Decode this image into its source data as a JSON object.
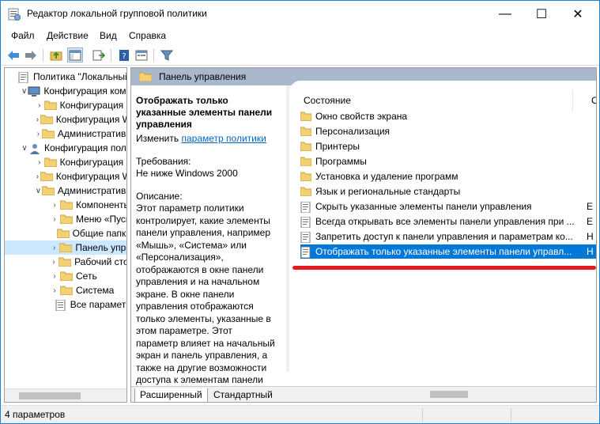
{
  "window": {
    "title": "Редактор локальной групповой политики"
  },
  "titlebar_buttons": {
    "minimize": "—",
    "maximize": "☐",
    "close": "✕"
  },
  "menu": [
    "Файл",
    "Действие",
    "Вид",
    "Справка"
  ],
  "tree": [
    {
      "label": "Политика \"Локальный",
      "level": 0,
      "expander": "",
      "icon": "policy-icon"
    },
    {
      "label": "Конфигурация комп",
      "level": 1,
      "expander": "∨",
      "icon": "computer-icon"
    },
    {
      "label": "Конфигурация п",
      "level": 2,
      "expander": "›",
      "icon": "folder-icon"
    },
    {
      "label": "Конфигурация W",
      "level": 2,
      "expander": "›",
      "icon": "folder-icon"
    },
    {
      "label": "Административн",
      "level": 2,
      "expander": "›",
      "icon": "folder-icon"
    },
    {
      "label": "Конфигурация поль",
      "level": 1,
      "expander": "∨",
      "icon": "user-icon"
    },
    {
      "label": "Конфигурация п",
      "level": 2,
      "expander": "›",
      "icon": "folder-icon"
    },
    {
      "label": "Конфигурация W",
      "level": 2,
      "expander": "›",
      "icon": "folder-icon"
    },
    {
      "label": "Административн",
      "level": 2,
      "expander": "∨",
      "icon": "folder-icon"
    },
    {
      "label": "Компоненты",
      "level": 3,
      "expander": "›",
      "icon": "folder-icon"
    },
    {
      "label": "Меню «Пуск",
      "level": 3,
      "expander": "›",
      "icon": "folder-icon"
    },
    {
      "label": "Общие папки",
      "level": 3,
      "expander": "",
      "icon": "folder-icon"
    },
    {
      "label": "Панель упра",
      "level": 3,
      "expander": "›",
      "icon": "folder-icon",
      "selected": true
    },
    {
      "label": "Рабочий сто.",
      "level": 3,
      "expander": "›",
      "icon": "folder-icon"
    },
    {
      "label": "Сеть",
      "level": 3,
      "expander": "›",
      "icon": "folder-icon"
    },
    {
      "label": "Система",
      "level": 3,
      "expander": "›",
      "icon": "folder-icon"
    },
    {
      "label": "Все параметр",
      "level": 3,
      "expander": "",
      "icon": "all-settings-icon"
    }
  ],
  "header": {
    "title": "Панель управления"
  },
  "description": {
    "title": "Отображать только указанные элементы панели управления",
    "edit_prefix": "Изменить",
    "edit_link": "параметр политики",
    "requirements_label": "Требования:",
    "requirements_value": "Не ниже Windows 2000",
    "description_label": "Описание:",
    "description_body": "Этот параметр политики контролирует, какие элементы панели управления, например «Мышь», «Система» или «Персонализация», отображаются в окне панели управления и на начальном экране. В окне панели управления отображаются только элементы, указанные в этом параметре. Этот параметр влияет на начальный экран и панель управления, а также на другие возможности доступа к элементам панели управления, например ссылки в центре"
  },
  "list": {
    "column_state": "Состояние",
    "column_second": "С",
    "items": [
      {
        "label": "Окно свойств экрана",
        "type": "folder",
        "trail": ""
      },
      {
        "label": "Персонализация",
        "type": "folder",
        "trail": ""
      },
      {
        "label": "Принтеры",
        "type": "folder",
        "trail": ""
      },
      {
        "label": "Программы",
        "type": "folder",
        "trail": ""
      },
      {
        "label": "Установка и удаление программ",
        "type": "folder",
        "trail": ""
      },
      {
        "label": "Язык и региональные стандарты",
        "type": "folder",
        "trail": ""
      },
      {
        "label": "Скрыть указанные элементы панели управления",
        "type": "setting",
        "trail": "Е"
      },
      {
        "label": "Всегда открывать все элементы панели управления при ...",
        "type": "setting",
        "trail": "Е"
      },
      {
        "label": "Запретить доступ к панели управления и параметрам ко...",
        "type": "setting",
        "trail": "Н"
      },
      {
        "label": "Отображать только указанные элементы панели управл...",
        "type": "setting",
        "trail": "Н",
        "selected": true
      }
    ]
  },
  "tabs": {
    "extended": "Расширенный",
    "standard": "Стандартный"
  },
  "status": {
    "text": "4 параметров"
  },
  "colors": {
    "accent": "#0078d7",
    "header_bar": "#a9b8cc",
    "highlight_underline": "#e41b23",
    "tree_selected": "#cce8ff"
  }
}
